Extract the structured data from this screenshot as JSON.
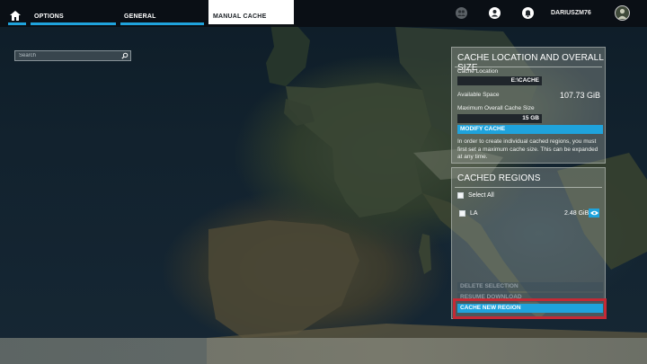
{
  "topbar": {
    "tabs": [
      {
        "label": "OPTIONS"
      },
      {
        "label": "GENERAL"
      },
      {
        "label": "MANUAL CACHE",
        "active": true
      }
    ],
    "username": "DARIUSZM76",
    "icons": [
      "home-icon",
      "friends-icon",
      "profile-icon",
      "notifications-icon",
      "avatar"
    ]
  },
  "search": {
    "placeholder": "Search",
    "value": ""
  },
  "cache_panel": {
    "title": "CACHE LOCATION AND OVERALL SIZE",
    "location_label": "Cache Location",
    "location_value": "E:\\CACHE",
    "available_label": "Available Space",
    "available_value": "107.73 GiB",
    "max_size_label": "Maximum Overall Cache Size",
    "max_size_value": "15 GB",
    "modify_button": "MODIFY CACHE",
    "info_text": "In order to create individual cached regions, you must first set a maximum cache size. This can be expanded at any time."
  },
  "regions_panel": {
    "title": "CACHED REGIONS",
    "select_all_label": "Select All",
    "regions": [
      {
        "name": "LA",
        "size": "2.48 GiB",
        "checked": false
      }
    ],
    "delete_button": "DELETE SELECTION",
    "resume_button": "RESUME DOWNLOAD",
    "cache_new_button": "CACHE NEW REGION"
  },
  "colors": {
    "accent": "#1fa3dc",
    "highlight": "#c42a35",
    "panel_bg": "#969e96"
  }
}
